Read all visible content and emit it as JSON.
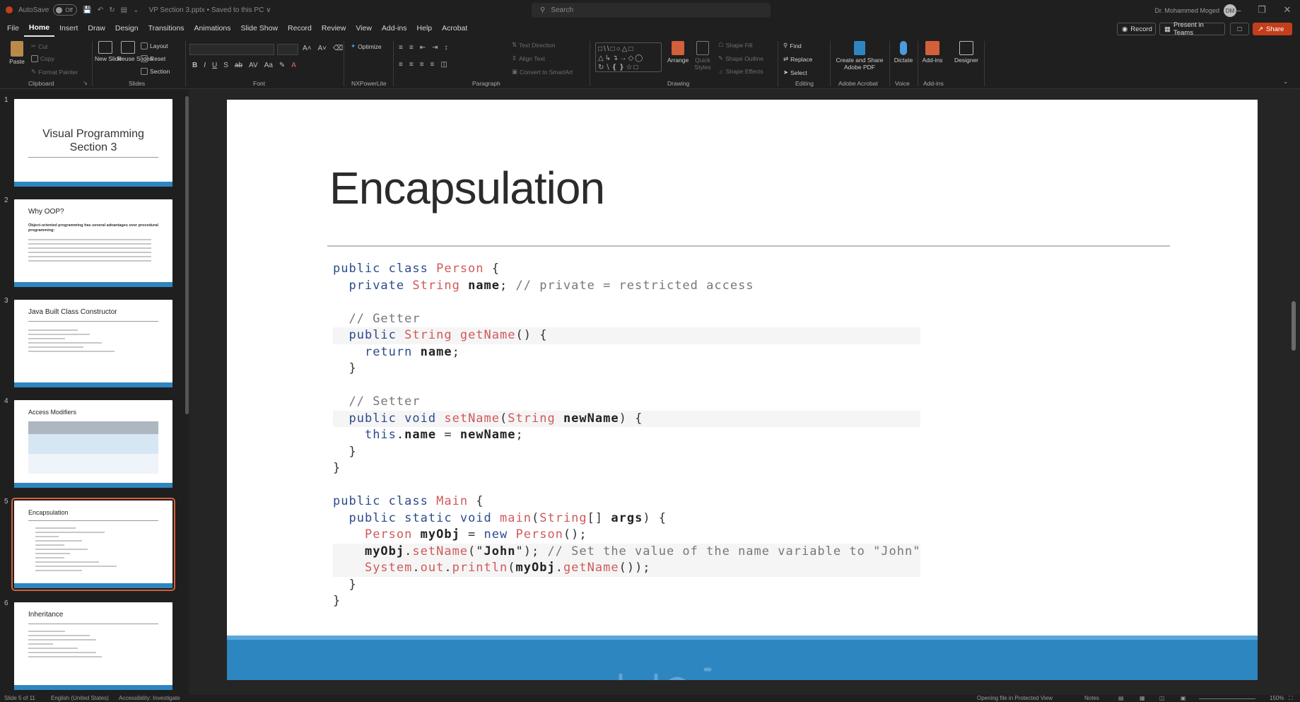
{
  "titlebar": {
    "autosave_label": "AutoSave",
    "autosave_state": "Off",
    "filename": "VP Section 3.pptx • Saved to this PC ∨",
    "search_placeholder": "Search",
    "user_name": "Dr. Mohammed Moged",
    "user_initials": "DM",
    "minimize": "—",
    "restore": "❒",
    "close": "✕"
  },
  "menu": {
    "tabs": [
      "File",
      "Home",
      "Insert",
      "Draw",
      "Design",
      "Transitions",
      "Animations",
      "Slide Show",
      "Record",
      "Review",
      "View",
      "Add-ins",
      "Help",
      "Acrobat"
    ],
    "active": "Home",
    "record_btn": "Record",
    "present_btn": "Present in Teams",
    "share_btn": "Share"
  },
  "ribbon": {
    "groups": [
      "Clipboard",
      "Slides",
      "Font",
      "NXPowerLite",
      "Paragraph",
      "Drawing",
      "Editing",
      "Adobe Acrobat",
      "Voice",
      "Add-ins"
    ],
    "clipboard": {
      "paste": "Paste",
      "cut": "Cut",
      "copy": "Copy",
      "format_painter": "Format Painter"
    },
    "slides": {
      "new_slide": "New Slide",
      "reuse_slides": "Reuse Slides",
      "layout": "Layout",
      "reset": "Reset",
      "section": "Section"
    },
    "nx": {
      "optimize": "Optimize"
    },
    "paragraph": {
      "text_direction": "Text Direction",
      "align_text": "Align Text",
      "convert_smartart": "Convert to SmartArt"
    },
    "drawing": {
      "arrange": "Arrange",
      "quick_styles": "Quick Styles",
      "shape_fill": "Shape Fill",
      "shape_outline": "Shape Outline",
      "shape_effects": "Shape Effects"
    },
    "editing": {
      "find": "Find",
      "replace": "Replace",
      "select": "Select"
    },
    "acrobat": {
      "create_share": "Create and Share Adobe PDF"
    },
    "voice": {
      "dictate": "Dictate"
    },
    "addins": {
      "addins": "Add-ins",
      "designer": "Designer"
    }
  },
  "thumbnails": [
    {
      "num": "1",
      "title": "Visual Programming Section 3"
    },
    {
      "num": "2",
      "title": "Why OOP?",
      "subtitle": "Object-oriented programming has several advantages over procedural programming:"
    },
    {
      "num": "3",
      "title": "Java Built Class Constructor"
    },
    {
      "num": "4",
      "title": "Access Modifiers"
    },
    {
      "num": "5",
      "title": "Encapsulation"
    },
    {
      "num": "6",
      "title": "Inheritance"
    }
  ],
  "selected_slide": 5,
  "slide": {
    "title": "Encapsulation",
    "code": [
      "public class Person {",
      "  private String name; // private = restricted access",
      "",
      "  // Getter",
      "  public String getName() {",
      "    return name;",
      "  }",
      "",
      "  // Setter",
      "  public void setName(String newName) {",
      "    this.name = newName;",
      "  }",
      "}",
      "",
      "public class Main {",
      "  public static void main(String[] args) {",
      "    Person myObj = new Person();",
      "    myObj.setName(\"John\"); // Set the value of the name variable to \"John\"",
      "    System.out.println(myObj.getName());",
      "  }",
      "}"
    ]
  },
  "statusbar": {
    "slide_of": "Slide 5 of 11",
    "language": "English (United States)",
    "accessibility": "Accessibility: Investigate",
    "protected": "Opening file in Protected View",
    "notes": "Notes",
    "zoom": "150%"
  }
}
